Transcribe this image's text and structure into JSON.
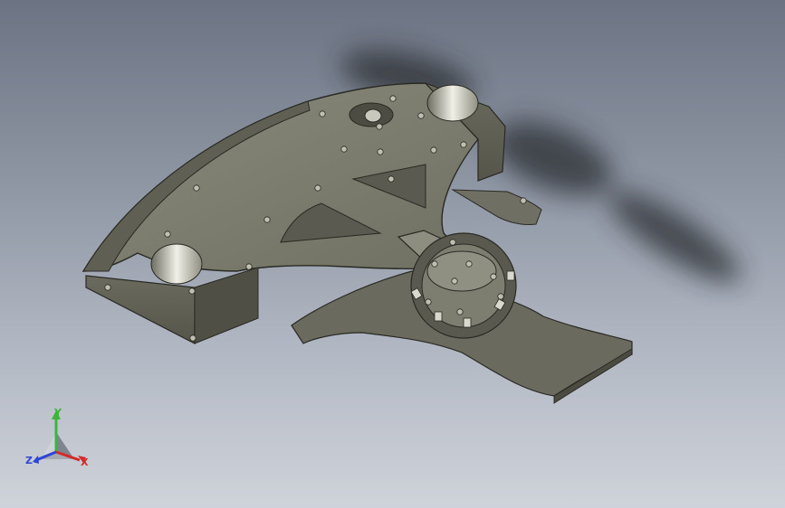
{
  "viewport": {
    "background_top": "#6c7382",
    "background_bottom": "#cfd3da"
  },
  "model": {
    "icon": "cad-assembly",
    "body_color": "#7b7b6d",
    "edge_color": "#2a2a24",
    "shaft_color": "#d8d8cc"
  },
  "triad": {
    "y_label": "Y",
    "z_label": "Z",
    "x_label": "X",
    "y_color": "#3db53d",
    "z_color": "#2d44d8",
    "x_color": "#d42a2a"
  }
}
